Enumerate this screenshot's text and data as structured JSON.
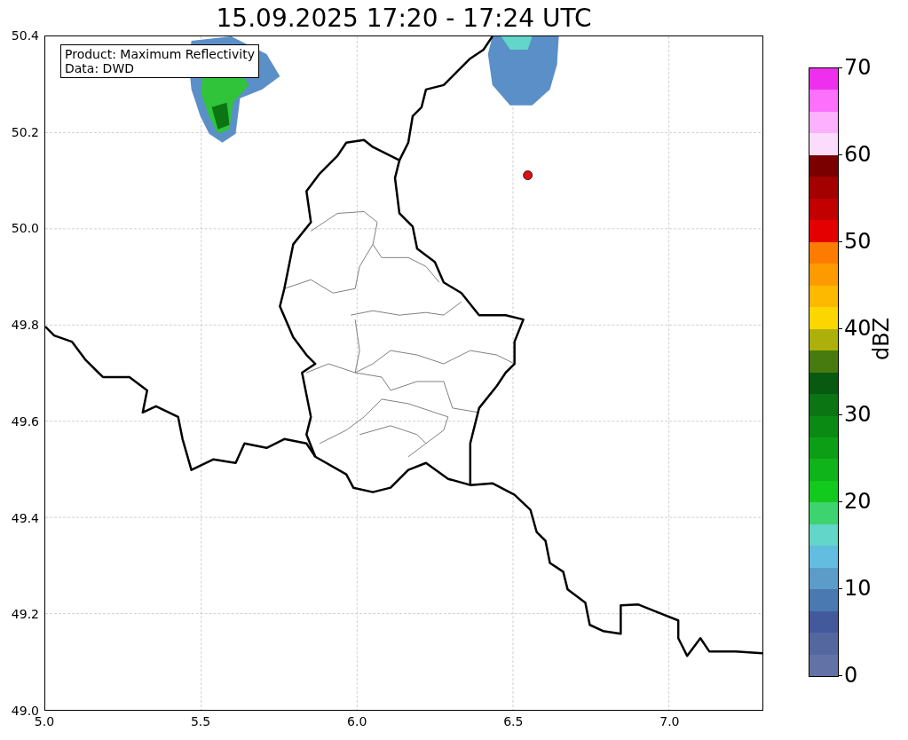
{
  "title": "15.09.2025 17:20 - 17:24 UTC",
  "info_box": [
    "Product: Maximum Reflectivity",
    "Data: DWD"
  ],
  "x_ticks": [
    "5.0",
    "5.5",
    "6.0",
    "6.5",
    "7.0"
  ],
  "y_ticks": [
    "50.4",
    "50.2",
    "50.0",
    "49.8",
    "49.6",
    "49.4",
    "49.2",
    "49.0"
  ],
  "colorbar": {
    "label": "dBZ",
    "ticks": [
      "70",
      "60",
      "50",
      "40",
      "30",
      "20",
      "10",
      "0"
    ],
    "bins": [
      {
        "color": "#ee30ee"
      },
      {
        "color": "#fc70fc"
      },
      {
        "color": "#fdb0fd"
      },
      {
        "color": "#fcdcfc"
      },
      {
        "color": "#7a0000"
      },
      {
        "color": "#a30000"
      },
      {
        "color": "#c20000"
      },
      {
        "color": "#e40000"
      },
      {
        "color": "#fd7c00"
      },
      {
        "color": "#fd9a00"
      },
      {
        "color": "#fdb800"
      },
      {
        "color": "#fdd600"
      },
      {
        "color": "#adb00a"
      },
      {
        "color": "#477a0f"
      },
      {
        "color": "#085a10"
      },
      {
        "color": "#0a7512"
      },
      {
        "color": "#0a8a13"
      },
      {
        "color": "#0c9f16"
      },
      {
        "color": "#0eb41a"
      },
      {
        "color": "#12c91e"
      },
      {
        "color": "#3dd36f"
      },
      {
        "color": "#62d6c8"
      },
      {
        "color": "#63bde0"
      },
      {
        "color": "#5b9cc8"
      },
      {
        "color": "#4a78b0"
      },
      {
        "color": "#425a9c"
      },
      {
        "color": "#54679f"
      },
      {
        "color": "#6372a6"
      }
    ]
  }
}
